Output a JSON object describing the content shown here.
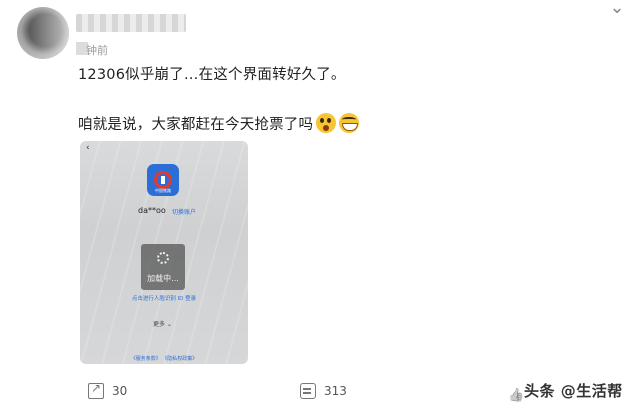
{
  "post": {
    "time_suffix": "钟前",
    "line1": "12306似乎崩了…在这个界面转好久了。",
    "line2": "咱就是说，大家都赶在今天抢票了吗",
    "emojis": [
      "astonished-emoji",
      "grin-emoji"
    ]
  },
  "screenshot": {
    "back": "‹",
    "app_icon_caption": "中国铁路",
    "account": "da**oo",
    "switch_account": "切换账户",
    "loading": "加载中...",
    "login_link": "点击进行人脸识别 ID 登录",
    "more_options": "更多 ⌄",
    "footer_links": "《服务条款》  《隐私权政策》"
  },
  "actions": {
    "share_count": "30",
    "comment_count": "313"
  },
  "watermark": "头条 @生活帮"
}
